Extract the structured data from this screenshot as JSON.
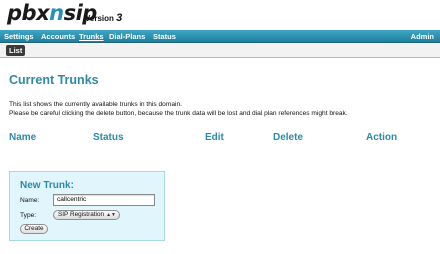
{
  "logo": {
    "part1": "pbx",
    "part2": "n",
    "part3": "sip",
    "version_label": "Version",
    "version_number": "3"
  },
  "nav": {
    "items": [
      {
        "label": "Settings"
      },
      {
        "label": "Accounts"
      },
      {
        "label": "Trunks",
        "active": true
      },
      {
        "label": "Dial-Plans"
      },
      {
        "label": "Status"
      }
    ],
    "admin_label": "Admin"
  },
  "subnav": {
    "tab_label": "List"
  },
  "main": {
    "title": "Current Trunks",
    "description_line1": "This list shows the currently available trunks in this domain.",
    "description_line2": "Please be careful clicking the delete button, because the trunk data will be lost and dial plan references might break.",
    "columns": [
      "Name",
      "Status",
      "Edit",
      "Delete",
      "Action"
    ]
  },
  "new_trunk": {
    "title": "New Trunk:",
    "name_label": "Name:",
    "name_value": "callcentric",
    "type_label": "Type:",
    "type_value": "SIP Registration",
    "create_label": "Create"
  },
  "colors": {
    "accent": "#2d8aa8",
    "nav_bg": "#2a8fb5",
    "box_bg": "#e0f6fc"
  }
}
